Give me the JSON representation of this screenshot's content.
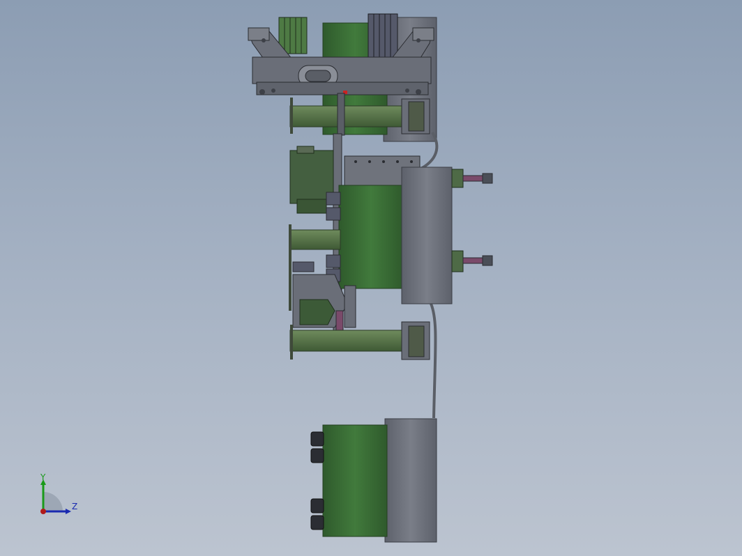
{
  "viewport": {
    "background_top": "#8c9db3",
    "background_bottom": "#bcc4d0"
  },
  "colors": {
    "motor_green": "#3b6a37",
    "steel_gray": "#6f7480",
    "dark_steel": "#4a4e57",
    "light_steel": "#8b8f98",
    "frame_green": "#5b7a4e",
    "rod_purple": "#7a4a6a"
  },
  "triad": {
    "y_label": "Y",
    "z_label": "Z",
    "y_color": "#1a9a1a",
    "z_color": "#1a2ab0",
    "x_color": "#b01a1a"
  }
}
